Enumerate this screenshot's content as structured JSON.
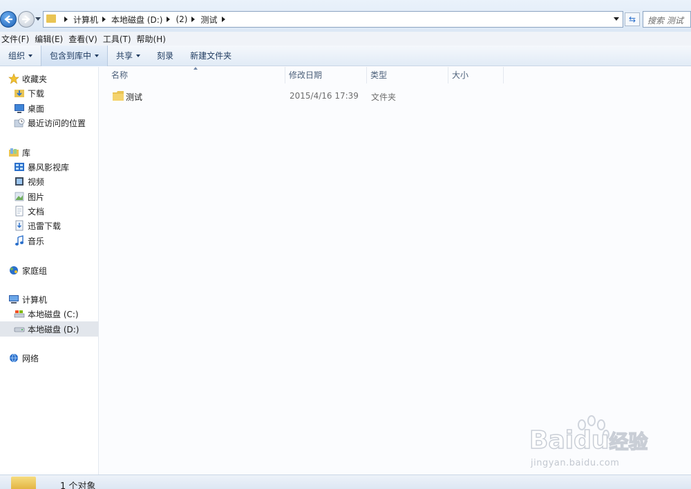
{
  "address": {
    "crumbs": [
      "计算机",
      "本地磁盘 (D:)",
      "(2)",
      "测试"
    ],
    "search_placeholder": "搜索 测试"
  },
  "menu": [
    "文件(F)",
    "编辑(E)",
    "查看(V)",
    "工具(T)",
    "帮助(H)"
  ],
  "toolbar": {
    "organize": "组织",
    "include_library": "包含到库中",
    "share": "共享",
    "burn": "刻录",
    "new_folder": "新建文件夹"
  },
  "nav": {
    "favorites": {
      "label": "收藏夹",
      "items": [
        "下载",
        "桌面",
        "最近访问的位置"
      ]
    },
    "libraries": {
      "label": "库",
      "items": [
        "暴风影视库",
        "视频",
        "图片",
        "文档",
        "迅雷下载",
        "音乐"
      ]
    },
    "homegroup": {
      "label": "家庭组"
    },
    "computer": {
      "label": "计算机",
      "items": [
        "本地磁盘 (C:)",
        "本地磁盘 (D:)"
      ]
    },
    "network": {
      "label": "网络"
    }
  },
  "columns": [
    "名称",
    "修改日期",
    "类型",
    "大小"
  ],
  "files": [
    {
      "name": "测试",
      "modified": "2015/4/16 17:39",
      "type": "文件夹",
      "size": ""
    }
  ],
  "status": {
    "text": "1 个对象"
  },
  "watermark": {
    "brand": "Bai",
    "brand2": "du",
    "cn": "经验",
    "url": "jingyan.baidu.com"
  },
  "colors": {
    "folder": "#e9c454",
    "accent": "#2a6fcb"
  }
}
